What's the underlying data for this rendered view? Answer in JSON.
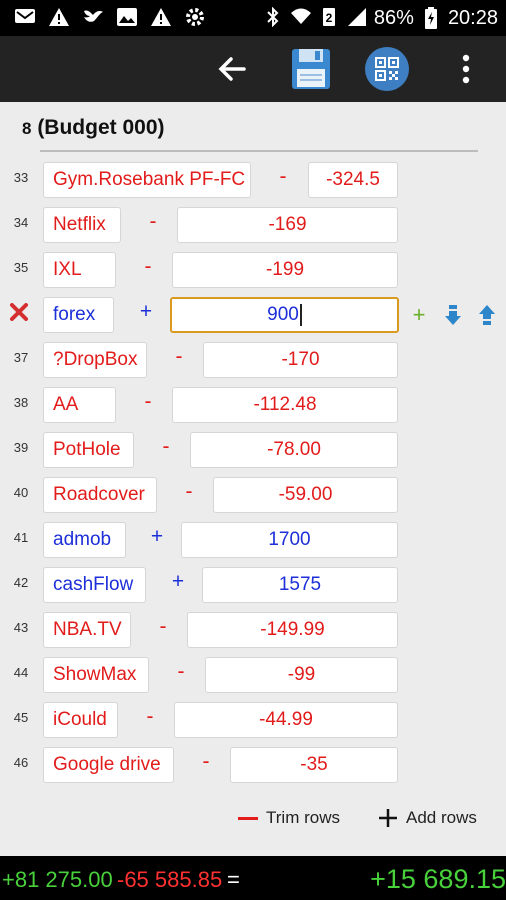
{
  "status_bar": {
    "battery": "86%",
    "time": "20:28",
    "icons": [
      "mail-icon",
      "warning-icon",
      "bird-icon",
      "image-icon",
      "warning-icon",
      "settings-icon",
      "bluetooth-icon",
      "wifi-icon",
      "sim2-icon",
      "signal-icon",
      "battery-charging-icon"
    ]
  },
  "toolbar": {
    "icons": [
      "back-arrow-icon",
      "save-icon",
      "qr-code-icon",
      "overflow-menu-icon"
    ]
  },
  "budget": {
    "number": "8",
    "title": "(Budget 000)"
  },
  "rows": [
    {
      "num": "33",
      "name": "Gym.Rosebank PF-FC",
      "sign": "-",
      "value": "-324.5",
      "kind": "neg"
    },
    {
      "num": "34",
      "name": "Netflix",
      "sign": "-",
      "value": "-169",
      "kind": "neg"
    },
    {
      "num": "35",
      "name": "IXL",
      "sign": "-",
      "value": "-199",
      "kind": "neg"
    },
    {
      "num": "",
      "name": "forex",
      "sign": "+",
      "value": "900",
      "kind": "pos",
      "active": true
    },
    {
      "num": "37",
      "name": "?DropBox",
      "sign": "-",
      "value": "-170",
      "kind": "neg"
    },
    {
      "num": "38",
      "name": "AA",
      "sign": "-",
      "value": "-112.48",
      "kind": "neg"
    },
    {
      "num": "39",
      "name": "PotHole",
      "sign": "-",
      "value": "-78.00",
      "kind": "neg"
    },
    {
      "num": "40",
      "name": "Roadcover",
      "sign": "-",
      "value": "-59.00",
      "kind": "neg"
    },
    {
      "num": "41",
      "name": "admob",
      "sign": "+",
      "value": "1700",
      "kind": "pos"
    },
    {
      "num": "42",
      "name": "cashFlow",
      "sign": "+",
      "value": "1575",
      "kind": "pos"
    },
    {
      "num": "43",
      "name": "NBA.TV",
      "sign": "-",
      "value": "-149.99",
      "kind": "neg"
    },
    {
      "num": "44",
      "name": "ShowMax",
      "sign": "-",
      "value": "-99",
      "kind": "neg"
    },
    {
      "num": "45",
      "name": "iCould",
      "sign": "-",
      "value": "-44.99",
      "kind": "neg"
    },
    {
      "num": "46",
      "name": "Google drive",
      "sign": "-",
      "value": "-35",
      "kind": "neg"
    }
  ],
  "active_row_controls": {
    "add": "+",
    "icons": [
      "delete-row-icon",
      "add-icon",
      "move-down-icon",
      "move-up-icon"
    ]
  },
  "actions": {
    "trim_label": "Trim rows",
    "add_label": "Add rows"
  },
  "totals": {
    "positive": "+81 275.00",
    "negative": "-65 585.85",
    "equals": "=",
    "total": "+15 689.15"
  },
  "colors": {
    "negative": "#e21b1b",
    "positive": "#1c2fd8",
    "active_border": "#d99a1f",
    "total_green": "#49d13b"
  }
}
